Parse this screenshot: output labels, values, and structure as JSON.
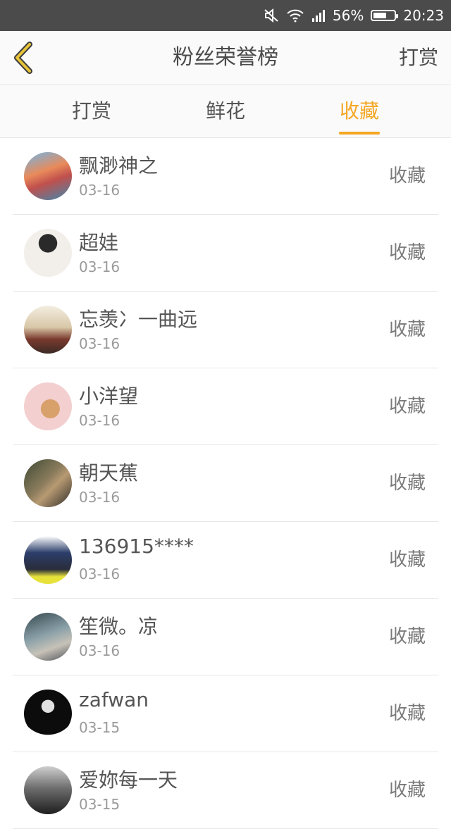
{
  "status_bar": {
    "battery": "56%",
    "time": "20:23",
    "icons": [
      "mute-icon",
      "wifi-icon",
      "signal-icon",
      "battery-icon"
    ]
  },
  "header": {
    "title": "粉丝荣誉榜",
    "action": "打赏",
    "back_icon": "chevron-left-icon",
    "back_color": "#e6c33a"
  },
  "tabs": [
    {
      "label": "打赏",
      "active": false
    },
    {
      "label": "鲜花",
      "active": false
    },
    {
      "label": "收藏",
      "active": true
    }
  ],
  "accent_color": "#f5a623",
  "fans": [
    {
      "name": "飘渺神之",
      "date": "03-16",
      "action": "收藏"
    },
    {
      "name": "超娃",
      "date": "03-16",
      "action": "收藏"
    },
    {
      "name": "忘羡冫一曲远",
      "date": "03-16",
      "action": "收藏"
    },
    {
      "name": "小洋望",
      "date": "03-16",
      "action": "收藏"
    },
    {
      "name": "朝天蕉",
      "date": "03-16",
      "action": "收藏"
    },
    {
      "name": "136915****",
      "date": "03-16",
      "action": "收藏"
    },
    {
      "name": "笙微。凉",
      "date": "03-16",
      "action": "收藏"
    },
    {
      "name": "zafwan",
      "date": "03-15",
      "action": "收藏"
    },
    {
      "name": "爱妳每一天",
      "date": "03-15",
      "action": "收藏"
    }
  ]
}
